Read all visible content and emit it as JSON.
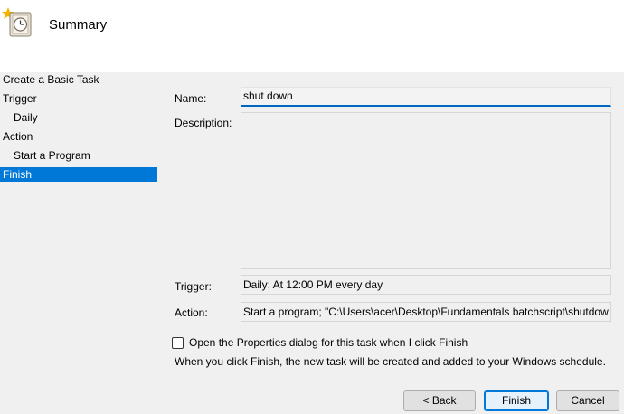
{
  "header": {
    "title": "Summary",
    "icon": "task-scheduler-clock-icon"
  },
  "sidebar": {
    "items": [
      {
        "label": "Create a Basic Task"
      },
      {
        "label": "Trigger"
      },
      {
        "label": "Daily"
      },
      {
        "label": "Action"
      },
      {
        "label": "Start a Program"
      },
      {
        "label": "Finish"
      }
    ],
    "selected_color": "#0078d7"
  },
  "form": {
    "name_label": "Name:",
    "name_value": "shut down",
    "description_label": "Description:",
    "description_value": "",
    "trigger_label": "Trigger:",
    "trigger_value": "Daily; At 12:00 PM every day",
    "action_label": "Action:",
    "action_value": "Start a program; \"C:\\Users\\acer\\Desktop\\Fundamentals batchscript\\shutdow"
  },
  "options": {
    "open_properties_label": "Open the Properties dialog for this task when I click Finish",
    "info_text": "When you click Finish, the new task will be created and added to your Windows schedule."
  },
  "buttons": {
    "back": "< Back",
    "finish": "Finish",
    "cancel": "Cancel"
  }
}
